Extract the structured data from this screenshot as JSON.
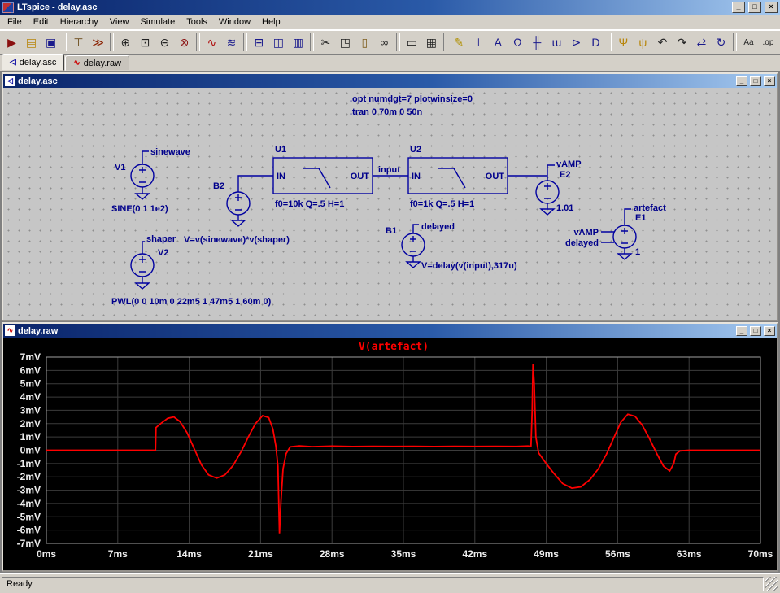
{
  "titlebar": {
    "title": "LTspice - delay.asc"
  },
  "window_controls": {
    "minimize": "_",
    "restore": "□",
    "close": "×"
  },
  "menu": {
    "items": [
      "File",
      "Edit",
      "Hierarchy",
      "View",
      "Simulate",
      "Tools",
      "Window",
      "Help"
    ]
  },
  "toolbar": {
    "items": [
      {
        "name": "new-schematic-icon",
        "glyph": "▶",
        "color": "#8a1010"
      },
      {
        "name": "open-icon",
        "glyph": "▤",
        "color": "#b8860b"
      },
      {
        "name": "save-icon",
        "glyph": "▣",
        "color": "#1a1a8c"
      },
      {
        "sep": true
      },
      {
        "name": "control-panel-icon",
        "glyph": "⊤",
        "color": "#6b4a1a"
      },
      {
        "name": "run-icon",
        "glyph": "≫",
        "color": "#8a2000"
      },
      {
        "sep": true
      },
      {
        "name": "zoom-in-icon",
        "glyph": "⊕",
        "color": "#222222"
      },
      {
        "name": "zoom-region-icon",
        "glyph": "⊡",
        "color": "#222222"
      },
      {
        "name": "zoom-out-icon",
        "glyph": "⊖",
        "color": "#222222"
      },
      {
        "name": "zoom-full-icon",
        "glyph": "⊗",
        "color": "#8a1010"
      },
      {
        "sep": true
      },
      {
        "name": "autorange-waveform-icon",
        "glyph": "∿",
        "color": "#b01010"
      },
      {
        "name": "plot-settings-icon",
        "glyph": "≋",
        "color": "#1a1a8c"
      },
      {
        "sep": true
      },
      {
        "name": "tile-horizontal-icon",
        "glyph": "⊟",
        "color": "#1a1a8c"
      },
      {
        "name": "tile-vertical-icon",
        "glyph": "◫",
        "color": "#1a1a8c"
      },
      {
        "name": "cascade-windows-icon",
        "glyph": "▥",
        "color": "#1a1a8c"
      },
      {
        "sep": true
      },
      {
        "name": "cut-icon",
        "glyph": "✂",
        "color": "#222222"
      },
      {
        "name": "copy-icon",
        "glyph": "◳",
        "color": "#222222"
      },
      {
        "name": "paste-icon",
        "glyph": "▯",
        "color": "#806020"
      },
      {
        "name": "find-icon",
        "glyph": "∞",
        "color": "#222222"
      },
      {
        "sep": true
      },
      {
        "name": "print-preview-icon",
        "glyph": "▭",
        "color": "#222222"
      },
      {
        "name": "print-icon",
        "glyph": "▦",
        "color": "#222222"
      },
      {
        "sep": true
      },
      {
        "name": "draft-wire-icon",
        "glyph": "✎",
        "color": "#b09000"
      },
      {
        "name": "ground-icon",
        "glyph": "⊥",
        "color": "#1a1a8c"
      },
      {
        "name": "label-net-icon",
        "glyph": "A",
        "color": "#1a1a8c"
      },
      {
        "name": "resistor-icon",
        "glyph": "Ω",
        "color": "#1a1a8c"
      },
      {
        "name": "capacitor-icon",
        "glyph": "╫",
        "color": "#1a1a8c"
      },
      {
        "name": "inductor-icon",
        "glyph": "ɯ",
        "color": "#1a1a8c"
      },
      {
        "name": "diode-icon",
        "glyph": "⊳",
        "color": "#1a1a8c"
      },
      {
        "name": "component-icon",
        "glyph": "D",
        "color": "#1a1a8c"
      },
      {
        "sep": true
      },
      {
        "name": "move-icon",
        "glyph": "Ψ",
        "color": "#b8860b"
      },
      {
        "name": "drag-icon",
        "glyph": "ψ",
        "color": "#b8860b"
      },
      {
        "name": "undo-icon",
        "glyph": "↶",
        "color": "#222222"
      },
      {
        "name": "redo-icon",
        "glyph": "↷",
        "color": "#222222"
      },
      {
        "name": "mirror-icon",
        "glyph": "⇄",
        "color": "#1a1a8c"
      },
      {
        "name": "rotate-icon",
        "glyph": "↻",
        "color": "#1a1a8c"
      },
      {
        "sep": true
      },
      {
        "name": "text-icon",
        "glyph": "Aa",
        "color": "#222222"
      },
      {
        "name": "spice-directive-icon",
        "glyph": ".op",
        "color": "#222222"
      }
    ]
  },
  "tabs": {
    "items": [
      {
        "label": "delay.asc",
        "icon": "◁"
      },
      {
        "label": "delay.raw",
        "icon": "∿"
      }
    ],
    "active_index": 0
  },
  "mdi": {
    "schematic_title": "delay.asc",
    "plot_title": "delay.raw",
    "schematic_icon": "◁",
    "plot_icon": "∿"
  },
  "schematic": {
    "directives": [
      ".opt numdgt=7 plotwinsize=0",
      ".tran 0 70m 0 50n"
    ],
    "v1": {
      "name": "V1",
      "net": "sinewave",
      "value": "SINE(0 1 1e2)"
    },
    "v2": {
      "name": "V2",
      "net": "shaper",
      "value": "PWL(0 0 10m 0 22m5 1 47m5 1 60m 0)"
    },
    "b2": {
      "name": "B2",
      "value": "V=v(sinewave)*v(shaper)"
    },
    "b1": {
      "name": "B1",
      "net": "delayed",
      "value": "V=delay(v(input),317u)"
    },
    "u1": {
      "name": "U1",
      "pin_in": "IN",
      "pin_out": "OUT",
      "value": "f0=10k Q=.5 H=1"
    },
    "u2": {
      "name": "U2",
      "pin_in": "IN",
      "pin_out": "OUT",
      "value": "f0=1k Q=.5 H=1"
    },
    "net_input": "input",
    "e2": {
      "name": "E2",
      "net": "vAMP",
      "value": "1.01"
    },
    "e1": {
      "name": "E1",
      "net": "artefact",
      "in_plus": "vAMP",
      "in_minus": "delayed",
      "value": "1"
    }
  },
  "chart_data": {
    "type": "line",
    "title": "V(artefact)",
    "x_unit": "ms",
    "y_unit": "mV",
    "xlim": [
      0,
      70
    ],
    "ylim": [
      -7,
      7
    ],
    "grid": true,
    "legend": "none",
    "x_ticks": [
      0,
      7,
      14,
      21,
      28,
      35,
      42,
      49,
      56,
      63,
      70
    ],
    "x_tick_labels": [
      "0ms",
      "7ms",
      "14ms",
      "21ms",
      "28ms",
      "35ms",
      "42ms",
      "49ms",
      "56ms",
      "63ms",
      "70ms"
    ],
    "y_ticks": [
      7,
      6,
      5,
      4,
      3,
      2,
      1,
      0,
      -1,
      -2,
      -3,
      -4,
      -5,
      -6,
      -7
    ],
    "y_tick_labels": [
      "7mV",
      "6mV",
      "5mV",
      "4mV",
      "3mV",
      "2mV",
      "1mV",
      "0mV",
      "-1mV",
      "-2mV",
      "-3mV",
      "-4mV",
      "-5mV",
      "-6mV",
      "-7mV"
    ],
    "series": [
      {
        "name": "V(artefact)",
        "color": "#ff0000",
        "points": [
          [
            0,
            0
          ],
          [
            10.7,
            0
          ],
          [
            10.75,
            1.7
          ],
          [
            11.2,
            2.0
          ],
          [
            11.9,
            2.4
          ],
          [
            12.5,
            2.5
          ],
          [
            13.1,
            2.15
          ],
          [
            13.8,
            1.3
          ],
          [
            14.5,
            0.1
          ],
          [
            15.2,
            -1.1
          ],
          [
            15.9,
            -1.85
          ],
          [
            16.7,
            -2.1
          ],
          [
            17.5,
            -1.85
          ],
          [
            18.3,
            -1.15
          ],
          [
            19.1,
            -0.1
          ],
          [
            19.8,
            1.0
          ],
          [
            20.5,
            2.0
          ],
          [
            21.2,
            2.6
          ],
          [
            21.8,
            2.45
          ],
          [
            22.2,
            1.6
          ],
          [
            22.5,
            0.3
          ],
          [
            22.7,
            -1.2
          ],
          [
            22.85,
            -6.25
          ],
          [
            23.0,
            -3.8
          ],
          [
            23.2,
            -1.4
          ],
          [
            23.5,
            -0.25
          ],
          [
            23.9,
            0.25
          ],
          [
            24.8,
            0.33
          ],
          [
            26,
            0.27
          ],
          [
            28,
            0.31
          ],
          [
            30,
            0.28
          ],
          [
            32,
            0.3
          ],
          [
            34,
            0.29
          ],
          [
            36,
            0.3
          ],
          [
            38,
            0.28
          ],
          [
            40,
            0.3
          ],
          [
            42,
            0.29
          ],
          [
            44,
            0.3
          ],
          [
            46,
            0.29
          ],
          [
            47.2,
            0.32
          ],
          [
            47.5,
            0.3
          ],
          [
            47.62,
            3.0
          ],
          [
            47.7,
            6.5
          ],
          [
            47.82,
            5.0
          ],
          [
            47.98,
            1.0
          ],
          [
            48.25,
            -0.2
          ],
          [
            48.9,
            -0.9
          ],
          [
            49.7,
            -1.7
          ],
          [
            50.6,
            -2.5
          ],
          [
            51.5,
            -2.85
          ],
          [
            52.4,
            -2.75
          ],
          [
            53.3,
            -2.2
          ],
          [
            54.1,
            -1.4
          ],
          [
            54.9,
            -0.3
          ],
          [
            55.6,
            0.9
          ],
          [
            56.3,
            2.1
          ],
          [
            57.0,
            2.7
          ],
          [
            57.7,
            2.55
          ],
          [
            58.4,
            1.9
          ],
          [
            59.1,
            0.9
          ],
          [
            59.8,
            -0.2
          ],
          [
            60.5,
            -1.2
          ],
          [
            61.1,
            -1.55
          ],
          [
            61.5,
            -1.0
          ],
          [
            61.7,
            -0.3
          ],
          [
            62.1,
            -0.05
          ],
          [
            63,
            0
          ],
          [
            70,
            0
          ]
        ]
      }
    ]
  },
  "statusbar": {
    "text": "Ready"
  }
}
